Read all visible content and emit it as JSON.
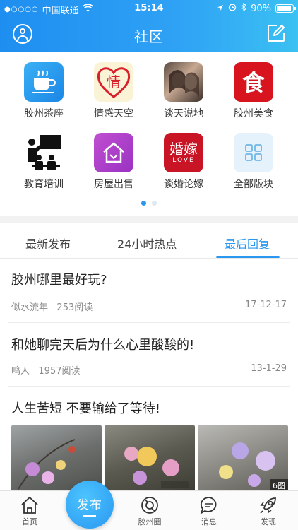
{
  "status": {
    "carrier": "中国联通",
    "time": "15:14",
    "battery": "90%"
  },
  "header": {
    "title": "社区"
  },
  "categories": [
    {
      "label": "胶州茶座",
      "icon": "teacup-icon"
    },
    {
      "label": "情感天空",
      "icon": "heart-qing-icon"
    },
    {
      "label": "谈天说地",
      "icon": "chat-photo-icon"
    },
    {
      "label": "胶州美食",
      "icon": "food-shi-icon"
    },
    {
      "label": "教育培训",
      "icon": "classroom-icon"
    },
    {
      "label": "房屋出售",
      "icon": "house-icon"
    },
    {
      "label": "谈婚论嫁",
      "icon": "wedding-love-icon",
      "text": "婚嫁",
      "sub": "LOVE"
    },
    {
      "label": "全部版块",
      "icon": "grid-icon"
    }
  ],
  "tabs": [
    {
      "label": "最新发布",
      "active": false
    },
    {
      "label": "24小时热点",
      "active": false
    },
    {
      "label": "最后回复",
      "active": true
    }
  ],
  "posts": [
    {
      "title": "胶州哪里最好玩?",
      "author": "似水流年",
      "reads": "253阅读",
      "date": "17-12-17"
    },
    {
      "title": "和她聊完天后为什么心里酸酸的!",
      "author": "鸣人",
      "reads": "1957阅读",
      "date": "13-1-29"
    },
    {
      "title": "人生苦短 不要输给了等待!",
      "image_count": "6图"
    }
  ],
  "bottom_nav": {
    "home": "首页",
    "publish": "发布",
    "circle": "胶州圈",
    "messages": "消息",
    "discover": "发现"
  },
  "colors": {
    "accent": "#2a97f0",
    "header_start": "#1e8ef0",
    "header_end": "#3bc1f2"
  }
}
